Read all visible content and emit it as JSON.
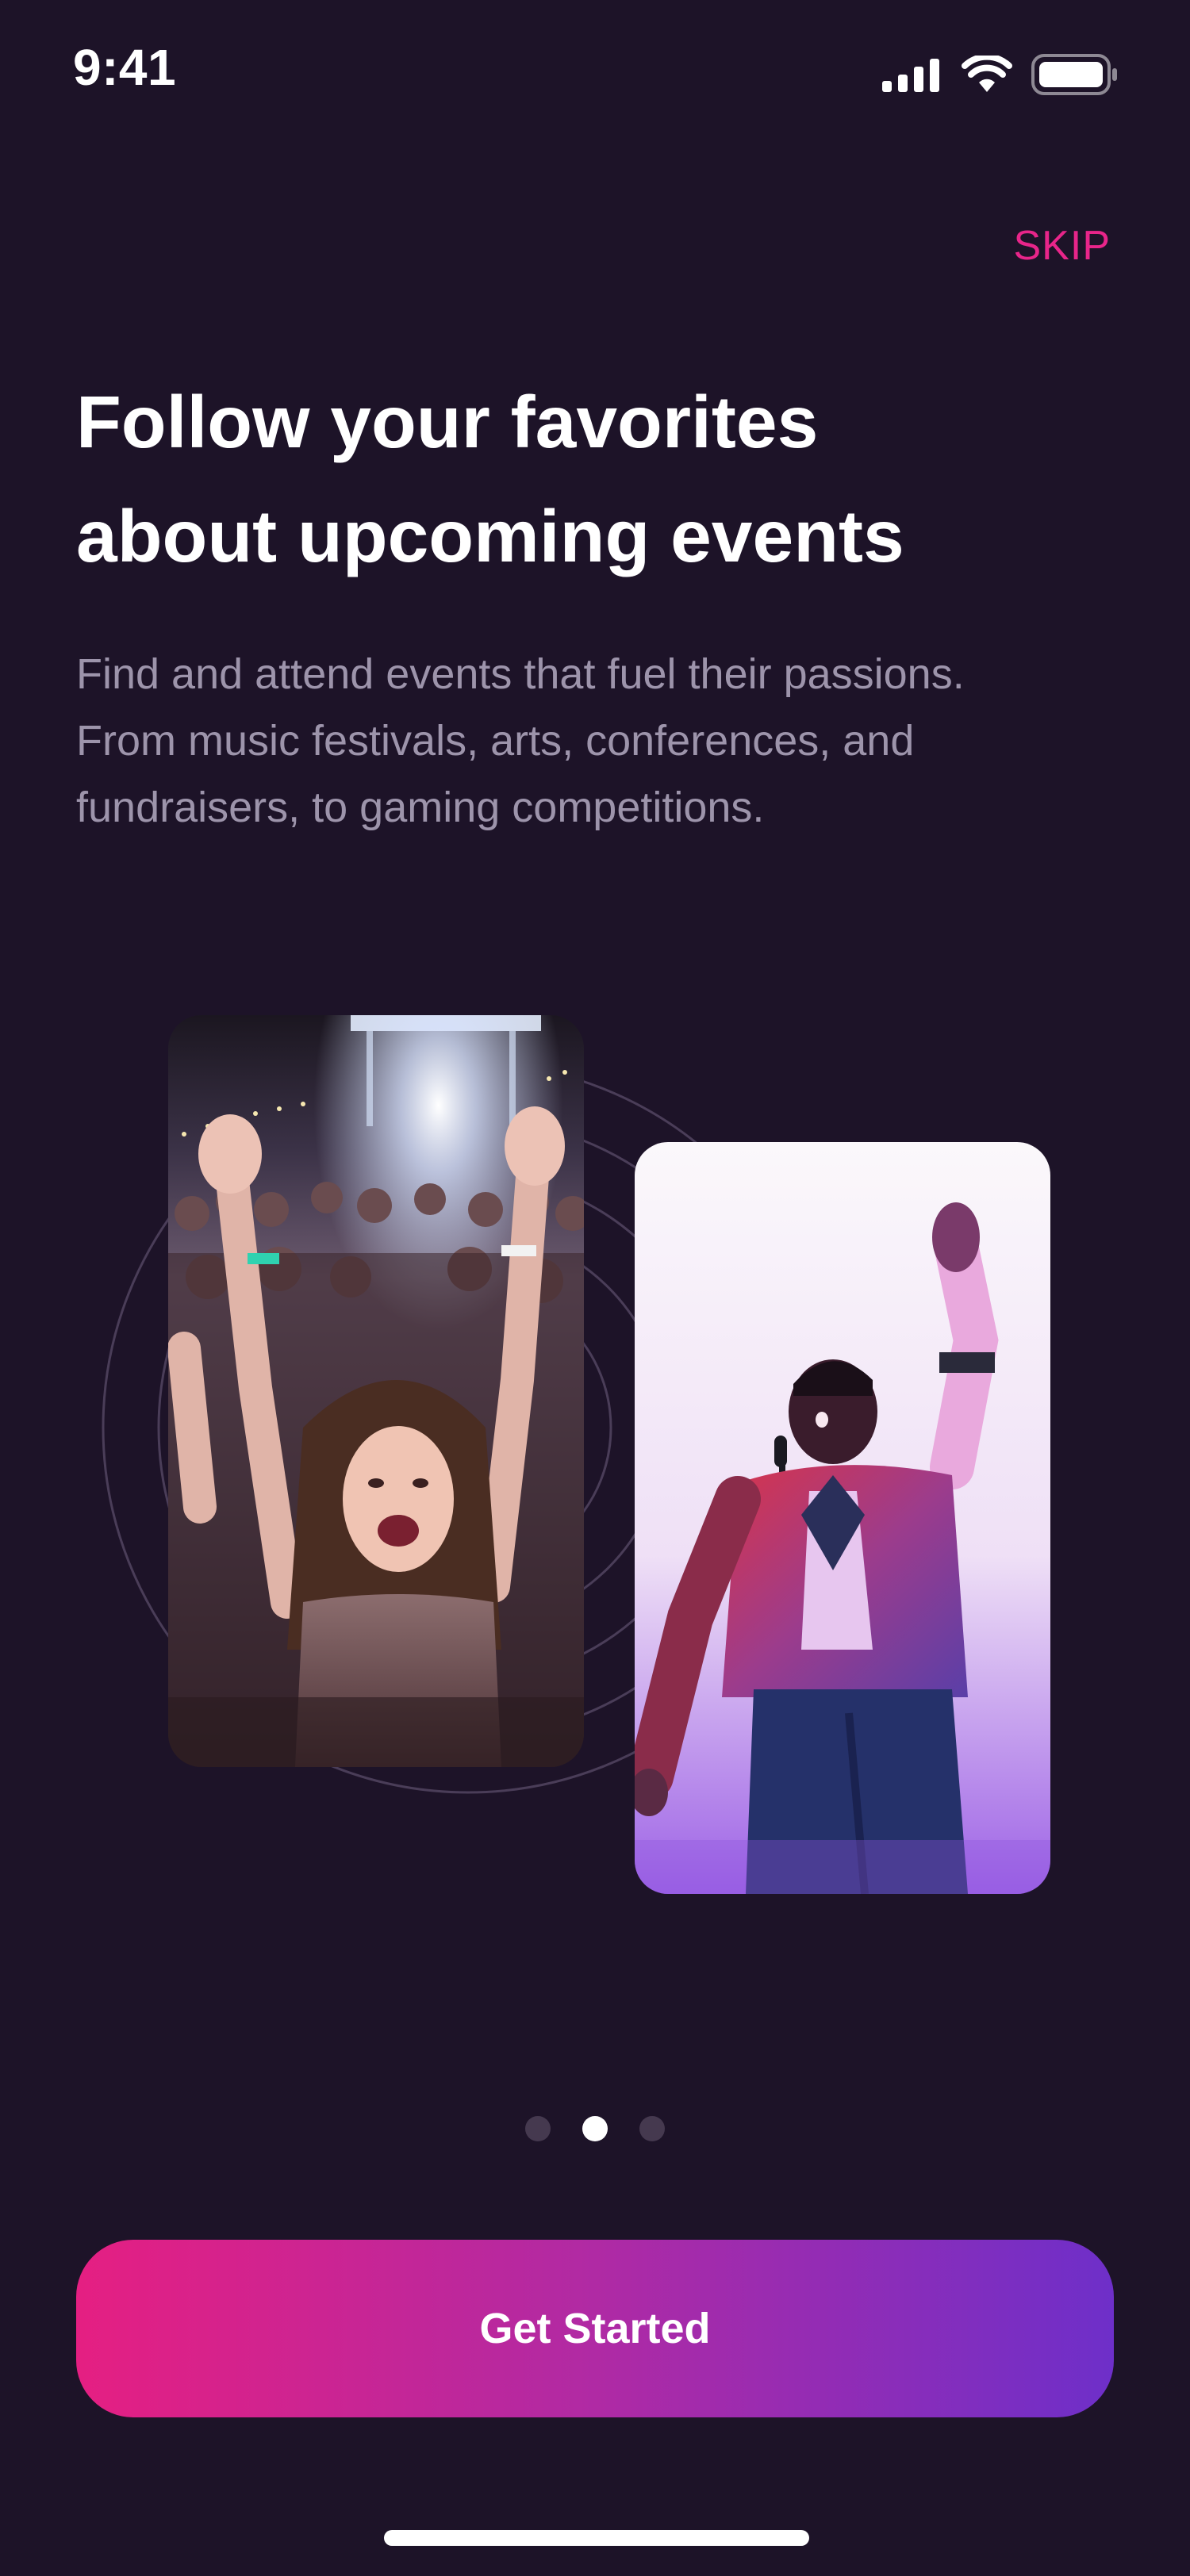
{
  "status_bar": {
    "time": "9:41"
  },
  "skip_label": "SKIP",
  "headline": {
    "line1": "Follow your favorites",
    "line2": "about upcoming events"
  },
  "subtitle": {
    "line1": "Find and attend events that fuel their passions.",
    "line2": "From music festivals, arts, conferences, and",
    "line3": "fundraisers, to gaming competitions."
  },
  "pager": {
    "count": 3,
    "active_index": 1
  },
  "cta_label": "Get Started",
  "colors": {
    "background": "#1d1328",
    "accent": "#e8258a",
    "gradient_start": "#e51f82",
    "gradient_end": "#6e2fc9",
    "subtitle_text": "#9d94ab"
  }
}
